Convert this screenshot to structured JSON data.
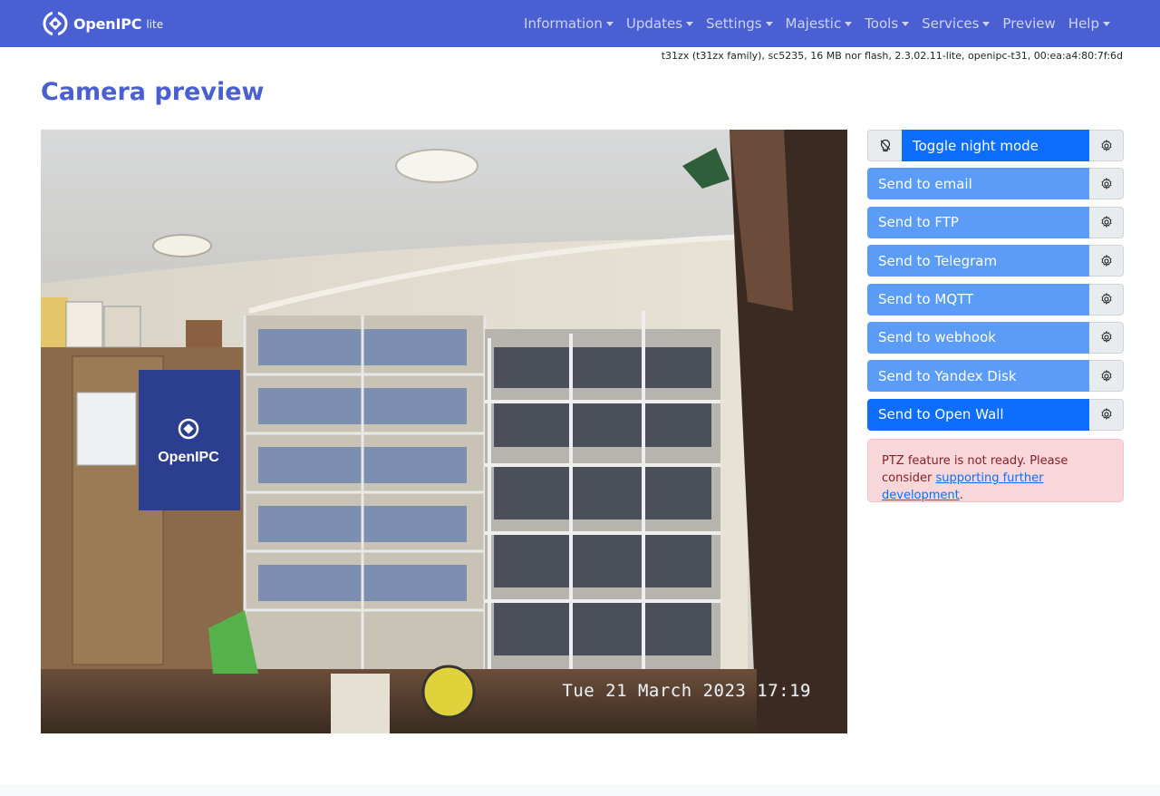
{
  "brand": {
    "name": "OpenIPC",
    "edition": "lite"
  },
  "nav": {
    "items": [
      {
        "label": "Information",
        "dropdown": true
      },
      {
        "label": "Updates",
        "dropdown": true
      },
      {
        "label": "Settings",
        "dropdown": true
      },
      {
        "label": "Majestic",
        "dropdown": true
      },
      {
        "label": "Tools",
        "dropdown": true
      },
      {
        "label": "Services",
        "dropdown": true
      },
      {
        "label": "Preview",
        "dropdown": false
      },
      {
        "label": "Help",
        "dropdown": true
      }
    ]
  },
  "device_info": "t31zx (t31zx family), sc5235, 16 MB nor flash, 2.3.02.11-lite, openipc-t31, 00:ea:a4:80:7f:6d",
  "page": {
    "title": "Camera preview"
  },
  "preview": {
    "timestamp": "Tue 21 March 2023 17:19",
    "banner_text": "OpenIPC"
  },
  "actions": {
    "night_mode": "Toggle night mode",
    "send_email": "Send to email",
    "send_ftp": "Send to FTP",
    "send_telegram": "Send to Telegram",
    "send_mqtt": "Send to MQTT",
    "send_webhook": "Send to webhook",
    "send_yandex": "Send to Yandex Disk",
    "send_openwall": "Send to Open Wall"
  },
  "alert": {
    "text": "PTZ feature is not ready. Please consider ",
    "link": "supporting further development",
    "suffix": "."
  },
  "colors": {
    "navbar": "#4a5fd1",
    "primary": "#0d6efd",
    "primary_light": "#5a9cf8",
    "alert_bg": "#f8d7da",
    "alert_text": "#842029"
  }
}
